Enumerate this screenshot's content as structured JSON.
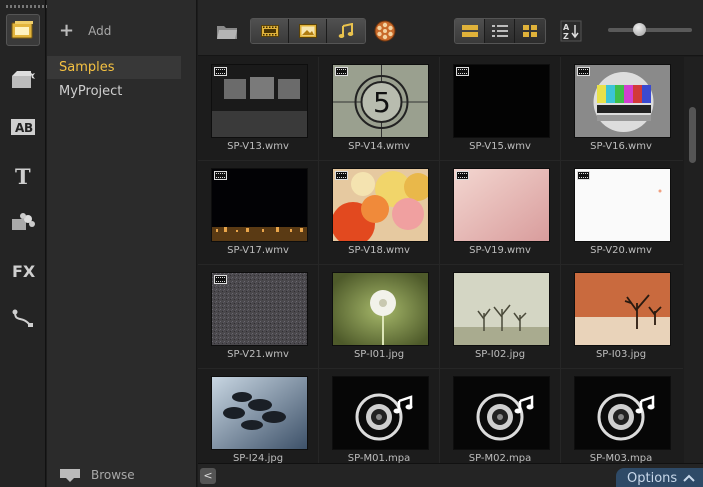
{
  "folder_panel": {
    "add_label": "Add",
    "folders": [
      {
        "label": "Samples",
        "selected": true
      },
      {
        "label": "MyProject",
        "selected": false
      }
    ],
    "browse_label": "Browse"
  },
  "rail": {
    "tools": [
      "media-library-icon",
      "instant-project-icon",
      "transition-icon",
      "title-icon",
      "graphic-icon",
      "filter-icon",
      "path-icon"
    ]
  },
  "toolbar": {
    "filter_buttons": [
      "video-filter-icon",
      "photo-filter-icon",
      "audio-filter-icon"
    ],
    "view_buttons": [
      "thumbnail-view-icon",
      "list-view-icon",
      "large-icon-view-icon"
    ],
    "zoom_level": 0.35
  },
  "media_items": [
    {
      "name": "SP-V13.wmv",
      "type": "video",
      "thumb": "stage-screens"
    },
    {
      "name": "SP-V14.wmv",
      "type": "video",
      "thumb": "countdown-5"
    },
    {
      "name": "SP-V15.wmv",
      "type": "video",
      "thumb": "black"
    },
    {
      "name": "SP-V16.wmv",
      "type": "video",
      "thumb": "test-card"
    },
    {
      "name": "SP-V17.wmv",
      "type": "video",
      "thumb": "city-night"
    },
    {
      "name": "SP-V18.wmv",
      "type": "video",
      "thumb": "balloons"
    },
    {
      "name": "SP-V19.wmv",
      "type": "video",
      "thumb": "pink"
    },
    {
      "name": "SP-V20.wmv",
      "type": "video",
      "thumb": "white"
    },
    {
      "name": "SP-V21.wmv",
      "type": "video",
      "thumb": "noise"
    },
    {
      "name": "SP-I01.jpg",
      "type": "image",
      "thumb": "dandelion"
    },
    {
      "name": "SP-I02.jpg",
      "type": "image",
      "thumb": "trees-fog"
    },
    {
      "name": "SP-I03.jpg",
      "type": "image",
      "thumb": "desert-tree"
    },
    {
      "name": "SP-I24.jpg",
      "type": "image",
      "thumb": "stones"
    },
    {
      "name": "SP-M01.mpa",
      "type": "audio",
      "thumb": "music"
    },
    {
      "name": "SP-M02.mpa",
      "type": "audio",
      "thumb": "music"
    },
    {
      "name": "SP-M03.mpa",
      "type": "audio",
      "thumb": "music"
    }
  ],
  "footer": {
    "options_label": "Options",
    "collapse_glyph": "<"
  },
  "colors": {
    "accent": "#f5c242",
    "options_bg": "#2e4a67"
  }
}
